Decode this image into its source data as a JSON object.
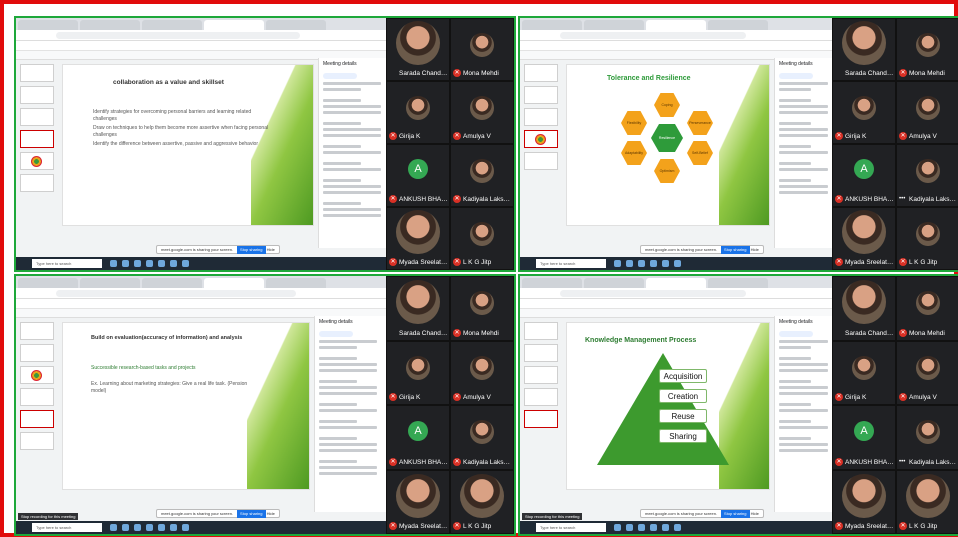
{
  "participants": [
    {
      "name": "Sarada Chandr...",
      "kind": "video"
    },
    {
      "name": "Mona Mehdi",
      "kind": "avatar"
    },
    {
      "name": "Girija K",
      "kind": "avatar"
    },
    {
      "name": "Amulya V",
      "kind": "avatar"
    },
    {
      "name": "ANKUSH BHAD...",
      "kind": "letter",
      "letter": "A"
    },
    {
      "name": "Kadiyala Laksh...",
      "kind": "avatar"
    },
    {
      "name": "Myada Sreelatha",
      "kind": "video"
    },
    {
      "name": "L K G Jitp",
      "kind": "avatar"
    }
  ],
  "q2_participants_row3_name": "Kadiyala Laksh...",
  "panel": {
    "title": "Meeting details"
  },
  "taskbar": {
    "search": "Type here to search"
  },
  "toast": {
    "text": "meet.google.com is sharing your screen.",
    "stop": "Stop sharing",
    "hide": "Hide"
  },
  "notice": "Stop recording for this meeting",
  "slides": {
    "q1": {
      "title": "collaboration as a value and skillset",
      "bullets": [
        "Identify strategies for overcoming personal barriers and learning related challenges",
        "Draw on techniques to help them become more assertive when facing personal challenges",
        "Identify the difference between assertive, passive and aggressive behavior"
      ]
    },
    "q2": {
      "title": "Tolerance and Resilience",
      "hexes": [
        "Coping",
        "Perseverance",
        "Self-Belief",
        "Optimism",
        "Adaptability",
        "Flexibility",
        "Growth",
        "Resilience"
      ]
    },
    "q3": {
      "title": "Build on evaluation(accuracy of information) and analysis",
      "bullets": [
        "Successible research-based tasks and projects",
        "Ex. Learning about marketing strategies: Give a real life task. (Pension model)"
      ]
    },
    "q4": {
      "title": "Knowledge Management Process",
      "steps": [
        "Acquisition",
        "Creation",
        "Reuse",
        "Sharing"
      ]
    }
  },
  "colors": {
    "outer_border": "#e10b0b",
    "quad_border": "#1ea83a",
    "accent_green": "#2e9b3a",
    "accent_orange": "#f3a21b"
  }
}
